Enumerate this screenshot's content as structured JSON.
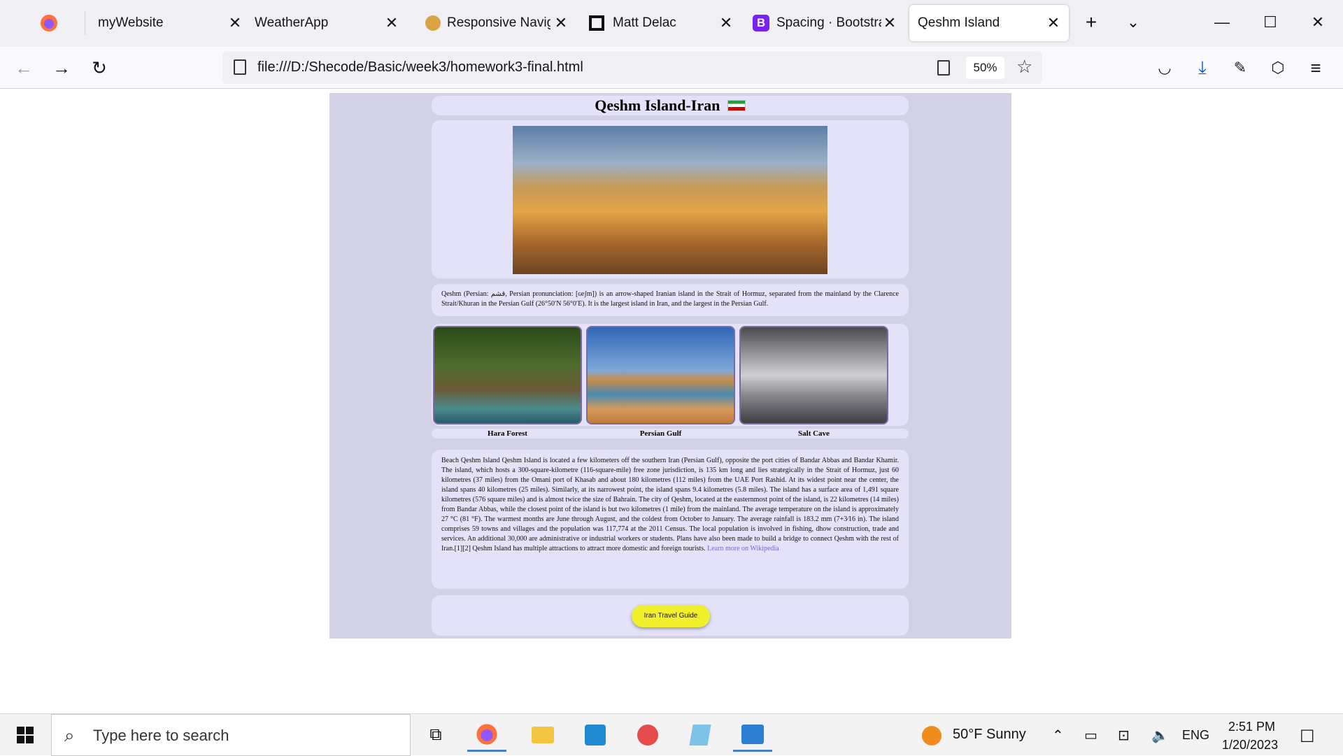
{
  "browser": {
    "tabs": [
      {
        "title": "",
        "icon": "firefox-icon"
      },
      {
        "title": "myWebsite"
      },
      {
        "title": "WeatherApp"
      },
      {
        "title": "Responsive Naviga"
      },
      {
        "title": "Matt Delac"
      },
      {
        "title": "Spacing · Bootstrap"
      },
      {
        "title": "Qeshm Island",
        "active": true
      }
    ],
    "url": "file:///D:/Shecode/Basic/week3/homework3-final.html",
    "zoom": "50%"
  },
  "page": {
    "title": "Qeshm Island-Iran",
    "intro": "Qeshm (Persian: قشم, Persian pronunciation: [ɢeʃm]) is an arrow-shaped Iranian island in the Strait of Hormuz, separated from the mainland by the Clarence Strait/Khuran in the Persian Gulf (26°50′N 56°0′E). It is the largest island in Iran, and the largest in the Persian Gulf.",
    "gallery": [
      {
        "caption": "Hara Forest"
      },
      {
        "caption": "Persian Gulf"
      },
      {
        "caption": "Salt Cave"
      }
    ],
    "body": "Beach Qeshm Island Qeshm Island is located a few kilometers off the southern Iran (Persian Gulf), opposite the port cities of Bandar Abbas and Bandar Khamir. The island, which hosts a 300-square-kilometre (116-square-mile) free zone jurisdiction, is 135 km long and lies strategically in the Strait of Hormuz, just 60 kilometres (37 miles) from the Omani port of Khasab and about 180 kilometres (112 miles) from the UAE Port Rashid. At its widest point near the center, the island spans 40 kilometres (25 miles). Similarly, at its narrowest point, the island spans 9.4 kilometres (5.8 miles). The island has a surface area of 1,491 square kilometres (576 square miles) and is almost twice the size of Bahrain. The city of Qeshm, located at the easternmost point of the island, is 22 kilometres (14 miles) from Bandar Abbas, while the closest point of the island is but two kilometres (1 mile) from the mainland. The average temperature on the island is approximately 27 °C (81 °F). The warmest months are June through August, and the coldest from October to January. The average rainfall is 183.2 mm (7+3⁄16 in). The island comprises 59 towns and villages and the population was 117,774 at the 2011 Census. The local population is involved in fishing, dhow construction, trade and services. An additional 30,000 are administrative or industrial workers or students. Plans have also been made to build a bridge to connect Qeshm with the rest of Iran.[1][2] Qeshm Island has multiple attractions to attract more domestic and foreign tourists.",
    "wiki_link": "Learn more on Wikipedia",
    "button": "Iran Travel Guide"
  },
  "taskbar": {
    "search_placeholder": "Type here to search",
    "weather": "50°F  Sunny",
    "language": "ENG",
    "time": "2:51 PM",
    "date": "1/20/2023"
  }
}
